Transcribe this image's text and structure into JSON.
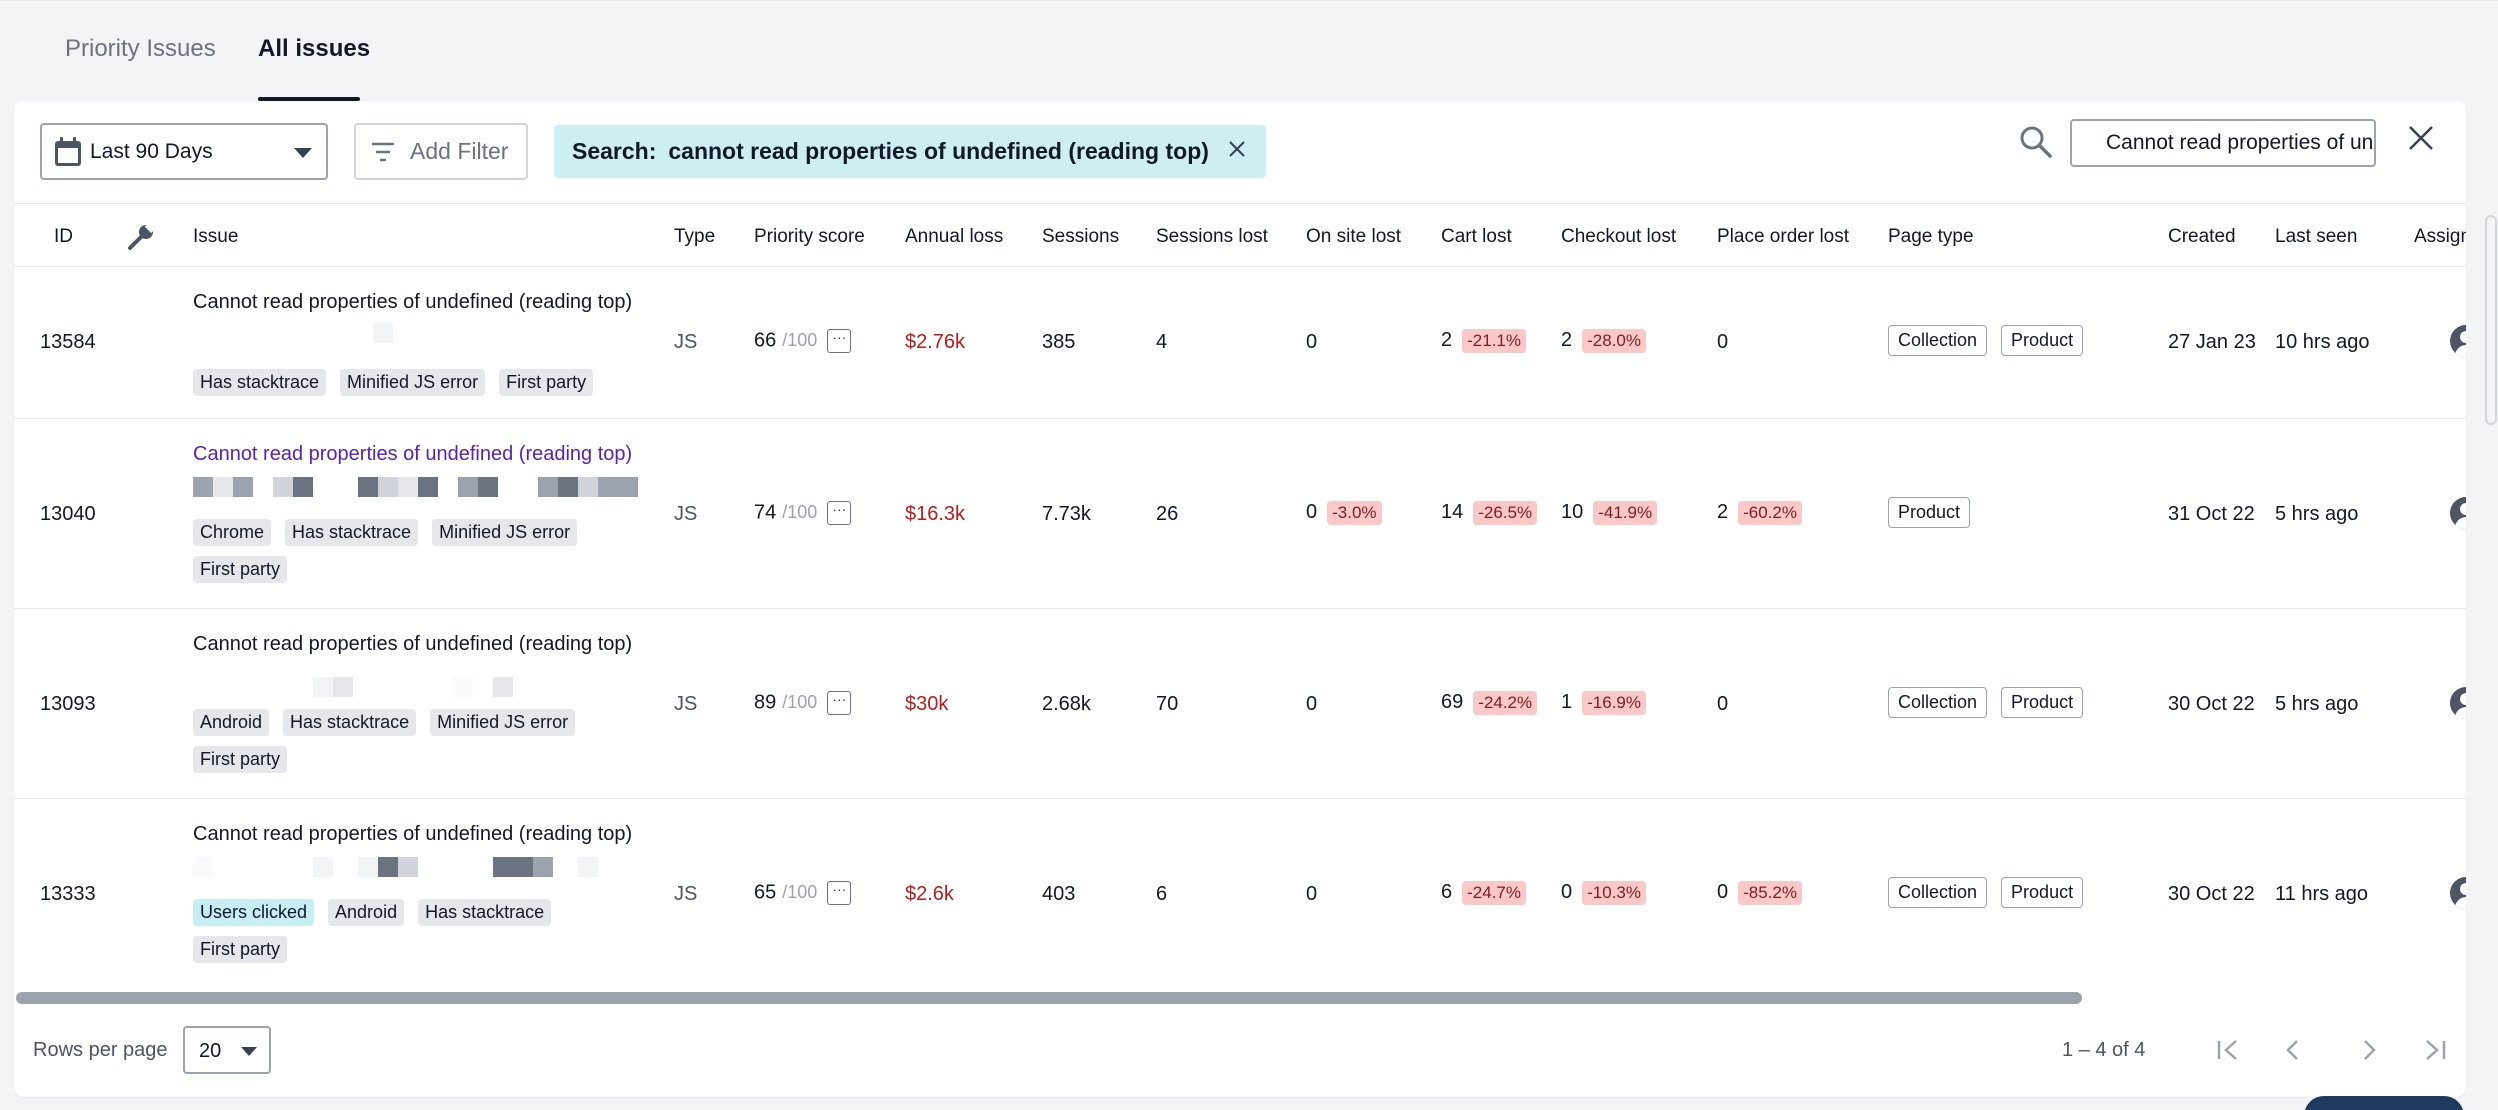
{
  "tabs": [
    {
      "label": "Priority Issues",
      "active": false
    },
    {
      "label": "All issues",
      "active": true
    }
  ],
  "toolbar": {
    "date_range": "Last 90 Days",
    "add_filter": "Add Filter",
    "search_chip_prefix": "Search:",
    "search_chip_value": "cannot read properties of undefined (reading top)",
    "search_input_value": "Cannot read properties of undefined (reading top)"
  },
  "columns": [
    "ID",
    "Issue",
    "Type",
    "Priority score",
    "Annual loss",
    "Sessions",
    "Sessions lost",
    "On site lost",
    "Cart lost",
    "Checkout lost",
    "Place order lost",
    "Page type",
    "Created",
    "Last seen",
    "Assign"
  ],
  "rows": [
    {
      "id": "13584",
      "title": "Cannot read properties of undefined (reading top)",
      "tags": [
        "Has stacktrace",
        "Minified JS error",
        "First party"
      ],
      "type": "JS",
      "priority": "66",
      "priority_of": "/100",
      "annual_loss": "$2.76k",
      "sessions": "385",
      "sessions_lost": "4",
      "on_site_lost": "0",
      "on_site_pct": "",
      "cart_lost": "2",
      "cart_pct": "-21.1%",
      "checkout_lost": "2",
      "checkout_pct": "-28.0%",
      "place_order_lost": "0",
      "place_order_pct": "",
      "page_types": [
        "Collection",
        "Product"
      ],
      "created": "27 Jan 23",
      "last_seen": "10 hrs ago"
    },
    {
      "id": "13040",
      "title": "Cannot read properties of undefined (reading top)",
      "tags": [
        "Chrome",
        "Has stacktrace",
        "Minified JS error",
        "First party"
      ],
      "type": "JS",
      "priority": "74",
      "priority_of": "/100",
      "annual_loss": "$16.3k",
      "sessions": "7.73k",
      "sessions_lost": "26",
      "on_site_lost": "0",
      "on_site_pct": "-3.0%",
      "cart_lost": "14",
      "cart_pct": "-26.5%",
      "checkout_lost": "10",
      "checkout_pct": "-41.9%",
      "place_order_lost": "2",
      "place_order_pct": "-60.2%",
      "page_types": [
        "Product"
      ],
      "created": "31 Oct 22",
      "last_seen": "5 hrs ago"
    },
    {
      "id": "13093",
      "title": "Cannot read properties of undefined (reading top)",
      "tags": [
        "Android",
        "Has stacktrace",
        "Minified JS error",
        "First party"
      ],
      "type": "JS",
      "priority": "89",
      "priority_of": "/100",
      "annual_loss": "$30k",
      "sessions": "2.68k",
      "sessions_lost": "70",
      "on_site_lost": "0",
      "on_site_pct": "",
      "cart_lost": "69",
      "cart_pct": "-24.2%",
      "checkout_lost": "1",
      "checkout_pct": "-16.9%",
      "place_order_lost": "0",
      "place_order_pct": "",
      "page_types": [
        "Collection",
        "Product"
      ],
      "created": "30 Oct 22",
      "last_seen": "5 hrs ago"
    },
    {
      "id": "13333",
      "title": "Cannot read properties of undefined (reading top)",
      "tags": [
        "Users clicked",
        "Android",
        "Has stacktrace",
        "First party"
      ],
      "type": "JS",
      "priority": "65",
      "priority_of": "/100",
      "annual_loss": "$2.6k",
      "sessions": "403",
      "sessions_lost": "6",
      "on_site_lost": "0",
      "on_site_pct": "",
      "cart_lost": "6",
      "cart_pct": "-24.7%",
      "checkout_lost": "0",
      "checkout_pct": "-10.3%",
      "place_order_lost": "0",
      "place_order_pct": "-85.2%",
      "page_types": [
        "Collection",
        "Product"
      ],
      "created": "30 Oct 22",
      "last_seen": "11 hrs ago"
    }
  ],
  "footer": {
    "rows_per_page_label": "Rows per page",
    "rows_per_page_value": "20",
    "range": "1 – 4 of 4"
  },
  "colors": {
    "accent_underline": "#111827",
    "search_chip_bg": "#cdeff3",
    "loss_text": "#b91c1c",
    "pct_badge_bg": "#fbc8c8",
    "visited_link": "#5b21b6"
  },
  "icons": [
    "calendar-icon",
    "filter-icon",
    "close-icon",
    "search-icon",
    "wrench-icon",
    "more-icon",
    "user-avatar-icon",
    "first-page-icon",
    "prev-page-icon",
    "next-page-icon",
    "last-page-icon"
  ]
}
